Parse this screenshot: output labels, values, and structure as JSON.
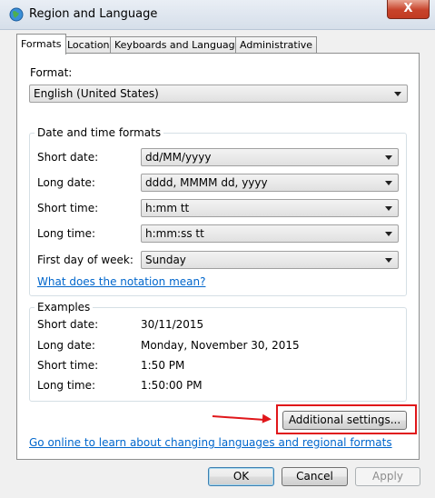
{
  "window": {
    "title": "Region and Language",
    "close_label": "X"
  },
  "tabs": [
    {
      "label": "Formats"
    },
    {
      "label": "Location"
    },
    {
      "label": "Keyboards and Languages"
    },
    {
      "label": "Administrative"
    }
  ],
  "format": {
    "label": "Format:",
    "value": "English (United States)"
  },
  "date_time": {
    "title": "Date and time formats",
    "rows": [
      {
        "label": "Short date:",
        "value": "dd/MM/yyyy"
      },
      {
        "label": "Long date:",
        "value": "dddd, MMMM dd, yyyy"
      },
      {
        "label": "Short time:",
        "value": "h:mm tt"
      },
      {
        "label": "Long time:",
        "value": "h:mm:ss tt"
      },
      {
        "label": "First day of week:",
        "value": "Sunday"
      }
    ],
    "notation_link": "What does the notation mean?"
  },
  "examples": {
    "title": "Examples",
    "rows": [
      {
        "label": "Short date:",
        "value": "30/11/2015"
      },
      {
        "label": "Long date:",
        "value": "Monday, November 30, 2015"
      },
      {
        "label": "Short time:",
        "value": "1:50 PM"
      },
      {
        "label": "Long time:",
        "value": "1:50:00 PM"
      }
    ]
  },
  "additional_settings_label": "Additional settings...",
  "online_link": "Go online to learn about changing languages and regional formats",
  "buttons": {
    "ok": "OK",
    "cancel": "Cancel",
    "apply": "Apply"
  },
  "colors": {
    "highlight": "#e0161a",
    "link": "#0066cc"
  },
  "icons": {
    "app": "globe-icon"
  }
}
